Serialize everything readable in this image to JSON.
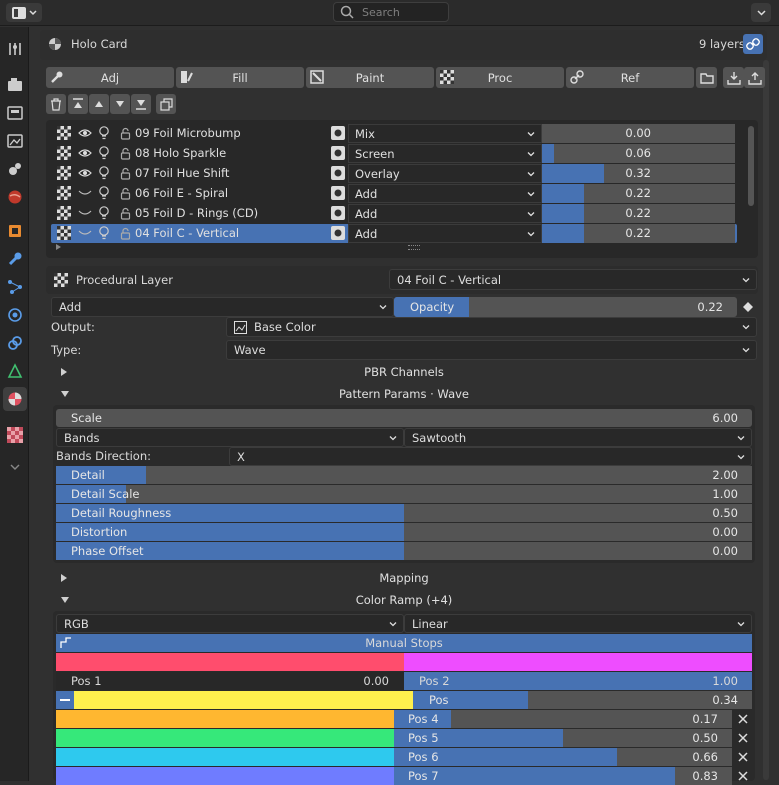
{
  "topbar": {
    "search_placeholder": "Search"
  },
  "panel": {
    "title": "Holo Card",
    "layer_count": "9 layers"
  },
  "tabs": [
    {
      "label": "Adj"
    },
    {
      "label": "Fill"
    },
    {
      "label": "Paint"
    },
    {
      "label": "Proc"
    },
    {
      "label": "Ref"
    }
  ],
  "layers": [
    {
      "name": "09 Foil Microbump",
      "blend": "Mix",
      "opacity": 0.0,
      "opacity_text": "0.00",
      "visible": true
    },
    {
      "name": "08 Holo Sparkle",
      "blend": "Screen",
      "opacity": 0.06,
      "opacity_text": "0.06",
      "visible": true
    },
    {
      "name": "07 Foil Hue Shift",
      "blend": "Overlay",
      "opacity": 0.32,
      "opacity_text": "0.32",
      "visible": true
    },
    {
      "name": "06 Foil E - Spiral",
      "blend": "Add",
      "opacity": 0.22,
      "opacity_text": "0.22",
      "visible": false
    },
    {
      "name": "05 Foil D - Rings (CD)",
      "blend": "Add",
      "opacity": 0.22,
      "opacity_text": "0.22",
      "visible": false
    },
    {
      "name": "04 Foil C - Vertical",
      "blend": "Add",
      "opacity": 0.22,
      "opacity_text": "0.22",
      "visible": false,
      "selected": true
    }
  ],
  "proc": {
    "header_label": "Procedural Layer",
    "layer_name": "04 Foil C - Vertical",
    "blend": "Add",
    "opacity_label": "Opacity",
    "opacity": 0.22,
    "opacity_text": "0.22",
    "output_label": "Output:",
    "output_value": "Base Color",
    "type_label": "Type:",
    "type_value": "Wave"
  },
  "sections": {
    "pbr": "PBR Channels",
    "pattern": "Pattern Params · Wave",
    "mapping": "Mapping",
    "ramp": "Color Ramp (+4)"
  },
  "pattern": {
    "scale_label": "Scale",
    "scale_value": "6.00",
    "bands": "Bands",
    "sawtooth": "Sawtooth",
    "direction_label": "Bands Direction:",
    "direction_value": "X",
    "rows": [
      {
        "label": "Detail",
        "value": "2.00",
        "fill": 0.13
      },
      {
        "label": "Detail Scale",
        "value": "1.00",
        "fill": 0.1
      },
      {
        "label": "Detail Roughness",
        "value": "0.50",
        "fill": 0.5
      },
      {
        "label": "Distortion",
        "value": "0.00",
        "fill": 0.5
      },
      {
        "label": "Phase Offset",
        "value": "0.00",
        "fill": 0.5
      }
    ]
  },
  "ramp": {
    "color_mode": "RGB",
    "interp": "Linear",
    "manual_stops": "Manual Stops",
    "pos1_label": "Pos 1",
    "pos1_value": "0.00",
    "pos2_label": "Pos 2",
    "pos2_value": "1.00",
    "pos_label": "Pos",
    "pos_value": "0.34",
    "pos_fill": 0.34,
    "stops": [
      {
        "label": "Pos 4",
        "value": "0.17",
        "fill": 0.17,
        "color": "#ffb730"
      },
      {
        "label": "Pos 5",
        "value": "0.50",
        "fill": 0.5,
        "color": "#36e87a"
      },
      {
        "label": "Pos 6",
        "value": "0.66",
        "fill": 0.66,
        "color": "#2ec9ee"
      },
      {
        "label": "Pos 7",
        "value": "0.83",
        "fill": 0.83,
        "color": "#6f7cff"
      }
    ],
    "color_left": "#ff4d6d",
    "color_right": "#ee4dff",
    "color_pos": "#fff04d"
  },
  "colors": {
    "accent": "#4772b3"
  }
}
